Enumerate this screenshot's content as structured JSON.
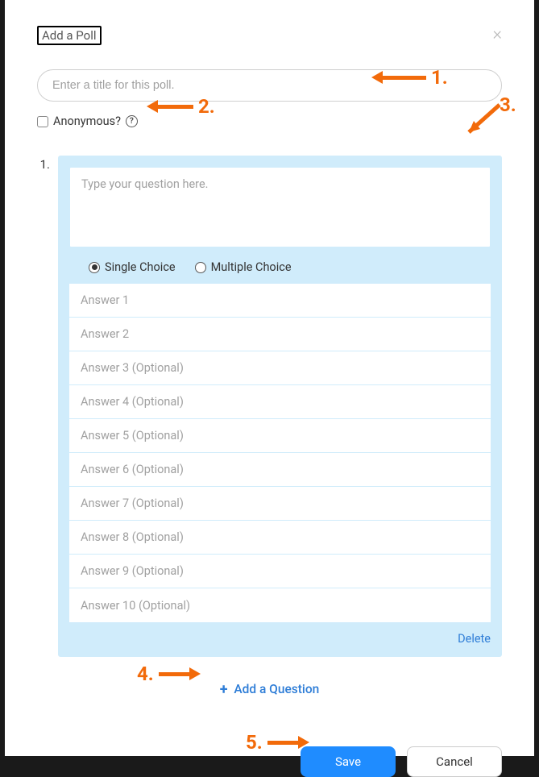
{
  "modal": {
    "title": "Add a Poll",
    "title_placeholder": "Enter a title for this poll.",
    "anonymous_label": "Anonymous?",
    "close_label": "×"
  },
  "question": {
    "number": "1.",
    "placeholder": "Type your question here.",
    "choice_type": {
      "single": "Single Choice",
      "multiple": "Multiple Choice",
      "selected": "single"
    },
    "answers": [
      {
        "placeholder": "Answer 1"
      },
      {
        "placeholder": "Answer 2"
      },
      {
        "placeholder": "Answer 3 (Optional)"
      },
      {
        "placeholder": "Answer 4 (Optional)"
      },
      {
        "placeholder": "Answer 5 (Optional)"
      },
      {
        "placeholder": "Answer 6 (Optional)"
      },
      {
        "placeholder": "Answer 7 (Optional)"
      },
      {
        "placeholder": "Answer 8 (Optional)"
      },
      {
        "placeholder": "Answer 9 (Optional)"
      },
      {
        "placeholder": "Answer 10 (Optional)"
      }
    ],
    "delete_label": "Delete"
  },
  "add_question": {
    "plus": "+",
    "label": "Add a Question"
  },
  "footer": {
    "save": "Save",
    "cancel": "Cancel"
  },
  "annotations": {
    "n1": "1.",
    "n2": "2.",
    "n3": "3.",
    "n4": "4.",
    "n5": "5."
  }
}
